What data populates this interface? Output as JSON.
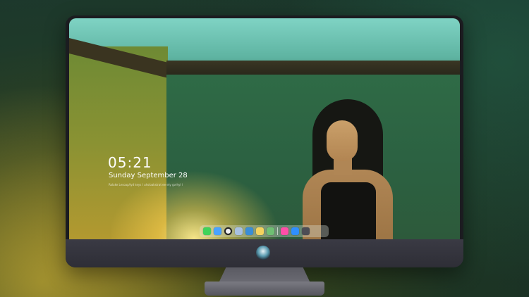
{
  "lockscreen": {
    "time": "05:21",
    "date": "Sunday September  28",
    "subtitle": "Rolake Lesoap/lyd keys I uhsloakstrat ee ety gvrhyl l"
  },
  "dock": {
    "apps": [
      {
        "name": "messages-icon",
        "color": "#3fd35a"
      },
      {
        "name": "finder-icon",
        "color": "#4aa3ff"
      },
      {
        "name": "clock-icon",
        "color": "#222222"
      },
      {
        "name": "photos-icon",
        "color": "#a9c1e0"
      },
      {
        "name": "video-icon",
        "color": "#3a8ed6"
      },
      {
        "name": "notes-icon",
        "color": "#f4d35e"
      },
      {
        "name": "maps-icon",
        "color": "#6fbf73"
      },
      {
        "name": "music-icon",
        "color": "#ff4fa8"
      },
      {
        "name": "appstore-icon",
        "color": "#2f8fff"
      },
      {
        "name": "system-icon",
        "color": "#4d4d55"
      }
    ]
  }
}
